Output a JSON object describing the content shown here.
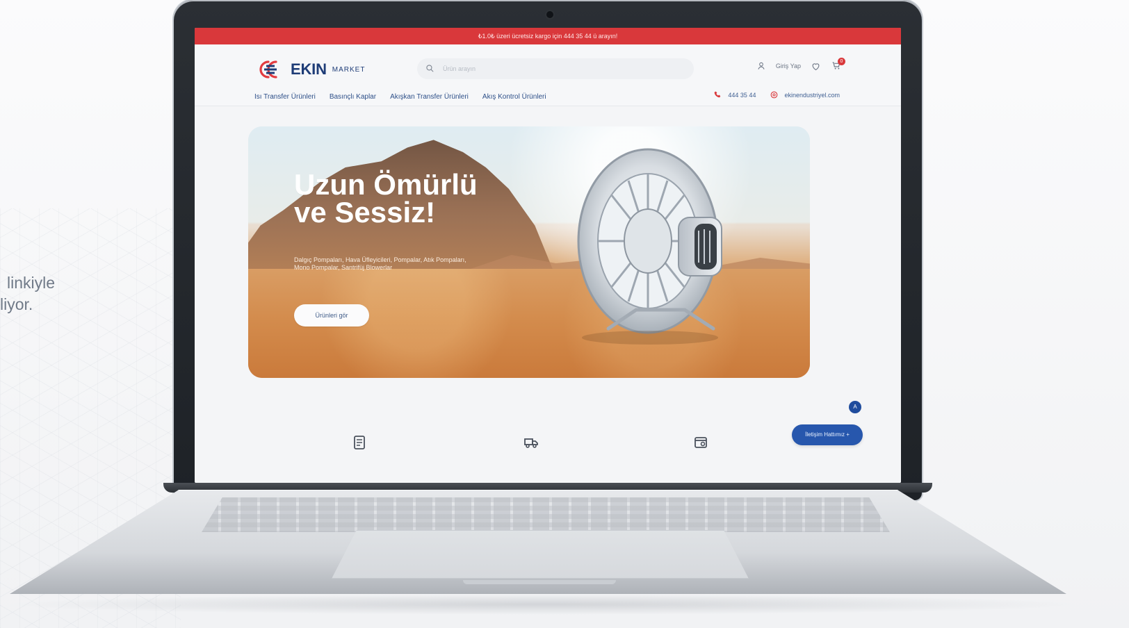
{
  "side_caption": {
    "line1": "linkiyle",
    "line2": "liyor."
  },
  "site": {
    "top_banner": "₺1.0₺ üzeri ücretsiz kargo için 444 35 44 ü arayın!",
    "brand": {
      "logo_text": "EKIN",
      "logo_sub": "MARKET"
    },
    "search": {
      "placeholder": "Ürün arayın"
    },
    "header_actions": {
      "login_label": "Giriş Yap",
      "cart_count": "0"
    },
    "nav": [
      "Isı Transfer Ürünleri",
      "Basınçlı Kaplar",
      "Akışkan Transfer Ürünleri",
      "Akış Kontrol Ürünleri"
    ],
    "contact": {
      "phone": "444 35 44",
      "email": "ekinendustriyel.com"
    },
    "hero": {
      "title_line1": "Uzun Ömürlü",
      "title_line2": "ve Sessiz!",
      "subtitle": "Dalgıç Pompaları, Hava Üfleyicileri, Pompalar, Atık Pompaları, Mono Pompalar, Santrifüj Blowerlar",
      "button_label": "Ürünleri gör"
    },
    "support": {
      "badge": "A",
      "button_label": "İletişim Hattımız +"
    }
  },
  "icons": {
    "search_icon": "search-icon",
    "user_icon": "user-icon",
    "heart_icon": "heart-icon",
    "cart_icon": "cart-icon",
    "phone_icon": "phone-icon",
    "email_icon": "email-icon",
    "feature1_icon": "document-icon",
    "feature2_icon": "truck-icon",
    "feature3_icon": "card-icon"
  },
  "colors": {
    "accent_red": "#d9383b",
    "accent_blue": "#2757ad",
    "logo_blue": "#1e3c77"
  }
}
